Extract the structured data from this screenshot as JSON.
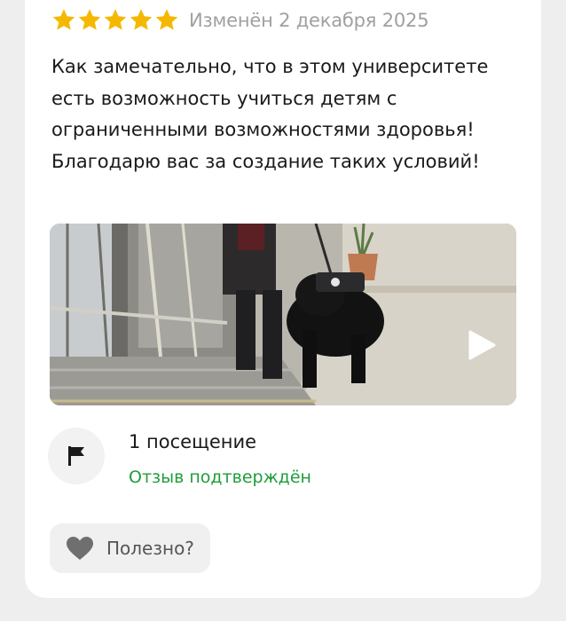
{
  "review": {
    "rating": 5,
    "rating_max": 5,
    "date": "Изменён 2 декабря 2025",
    "text": "Как замечательно, что в этом университете есть возможность учиться детям с ограниченными возможностями здоровья! Благодарю вас за создание таких условий!"
  },
  "media": {
    "type": "video",
    "icon": "play-icon"
  },
  "visit": {
    "icon": "flag-icon",
    "count_label": "1 посещение",
    "verified_label": "Отзыв подтверждён"
  },
  "helpful": {
    "icon": "heart-icon",
    "label": "Полезно?"
  },
  "colors": {
    "star": "#f5b800",
    "verified": "#1f9d3b",
    "date": "#a0a0a0"
  }
}
